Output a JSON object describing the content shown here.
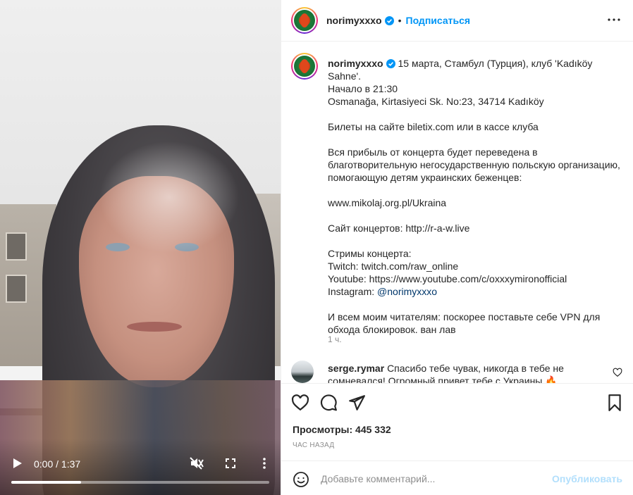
{
  "video": {
    "current_time": "0:00",
    "duration": "1:37",
    "time_separator": "/",
    "progress_fraction": 0.27
  },
  "post": {
    "username": "norimyxxxo",
    "follow_label": "Подписаться",
    "caption_lines": [
      "15 марта, Стамбул (Турция), клуб 'Kadıköy Sahne'.",
      "Начало в 21:30",
      "Osmanağa, Kirtasiyeci Sk. No:23, 34714 Kadıköy",
      "",
      "Билеты на сайте biletix.com или в кассе клуба",
      "",
      "Вся прибыль от концерта будет переведена в",
      "благотворительную негосударственную польскую организацию,",
      "помогающую детям украинских беженцев:",
      "",
      "www.mikolaj.org.pl/Ukraina",
      "",
      "Сайт концертов: http://r-a-w.live",
      "",
      "Стримы концерта:",
      "Twitch: twitch.com/raw_online",
      "Youtube: https://www.youtube.com/c/oxxxymironofficial",
      "",
      "",
      "И всем моим читателям: поскорее поставьте себе VPN для",
      "обхода блокировок. ван лав"
    ],
    "instagram_prefix": "Instagram: ",
    "instagram_mention": "@norimyxxxo",
    "time_ago": "1 ч.",
    "comment": {
      "username": "serge.rymar",
      "text": "Спасибо тебе чувак, никогда в тебе не сомневался! Огромный привет тебе с Украины 🔥"
    },
    "views_label": "Просмотры: 445 332",
    "posted_label": "ЧАС НАЗАД",
    "add_comment_placeholder": "Добавьте комментарий...",
    "publish_label": "Опубликовать"
  },
  "icons": {
    "play": "play-icon",
    "mute": "speaker-muted-icon",
    "fullscreen": "fullscreen-icon",
    "video_more": "vertical-dots-icon",
    "more": "horizontal-dots-icon",
    "like": "heart-icon",
    "comment": "comment-bubble-icon",
    "share": "paper-plane-icon",
    "save": "bookmark-icon",
    "emoji": "smiley-icon",
    "verified": "verified-badge-icon"
  },
  "colors": {
    "accent": "#0095f6",
    "text": "#262626",
    "muted": "#8e8e8e",
    "publish_disabled": "#b2dffc"
  }
}
